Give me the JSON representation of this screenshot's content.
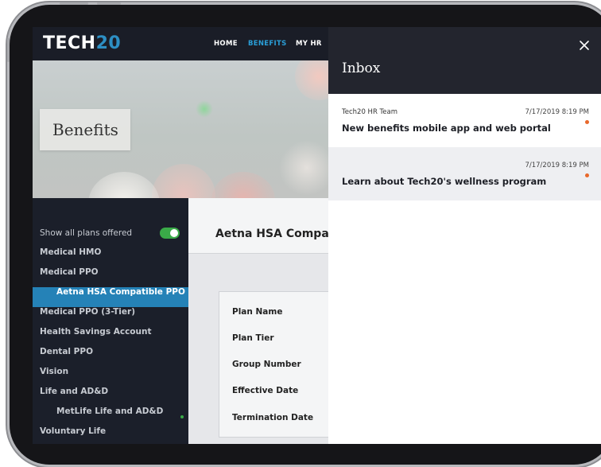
{
  "header": {
    "logo_text": "TECH",
    "logo_num": "20",
    "nav": [
      "HOME",
      "BENEFITS",
      "MY HR"
    ]
  },
  "hero": {
    "title": "Benefits"
  },
  "sidebar": {
    "toggle_label": "Show all plans offered",
    "toggle_on": true,
    "items": [
      {
        "label": "Medical HMO"
      },
      {
        "label": "Medical PPO"
      },
      {
        "label": "Aetna HSA Compatible PPO",
        "selected": true
      },
      {
        "label": "Medical PPO (3-Tier)"
      },
      {
        "label": "Health Savings Account"
      },
      {
        "label": "Dental PPO"
      },
      {
        "label": "Vision"
      },
      {
        "label": "Life and AD&D"
      },
      {
        "label": "MetLife Life and AD&D"
      },
      {
        "label": "Voluntary Life"
      }
    ]
  },
  "main": {
    "plan_title": "Aetna HSA Compati",
    "detail_labels": [
      "Plan Name",
      "Plan Tier",
      "Group Number",
      "Effective Date",
      "Termination Date"
    ]
  },
  "inbox": {
    "title": "Inbox",
    "close_icon": "close-icon",
    "messages": [
      {
        "sender": "Tech20 HR Team",
        "date": "7/17/2019 8:19 PM",
        "subject": "New benefits mobile app and web portal",
        "unread": true
      },
      {
        "sender": "",
        "date": "7/17/2019 8:19 PM",
        "subject": "Learn about Tech20's wellness program",
        "unread": true
      }
    ]
  },
  "colors": {
    "accent": "#2a9fd8",
    "selected_item": "#2582b7",
    "toggle_on": "#3aaa48",
    "unread_dot": "#e8682b"
  }
}
